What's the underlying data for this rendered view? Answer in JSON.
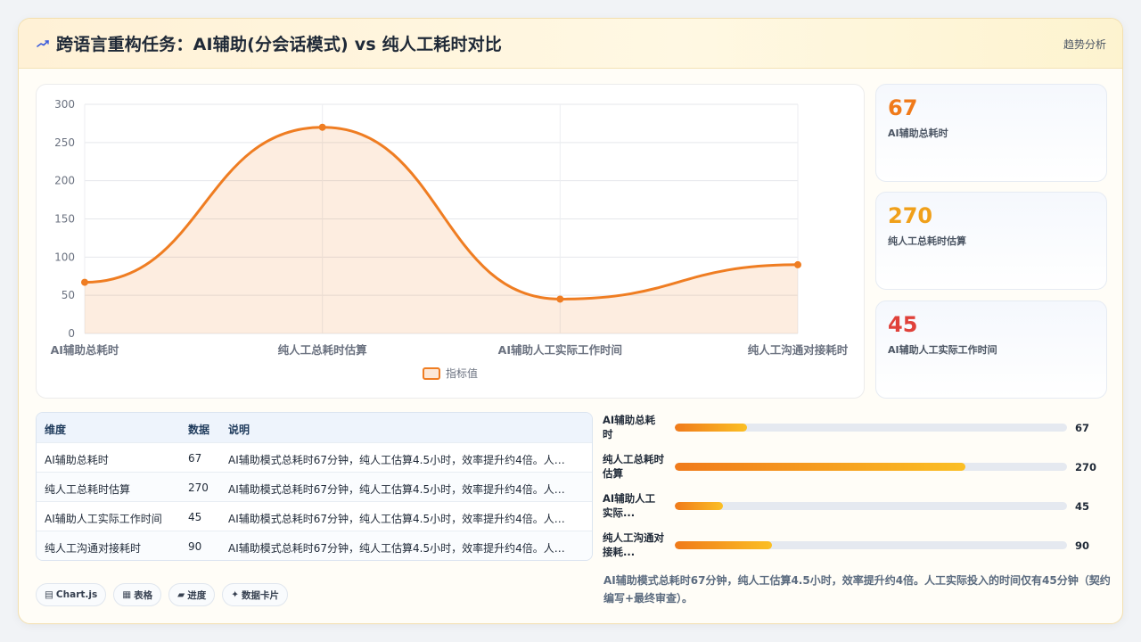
{
  "header": {
    "title": "跨语言重构任务：AI辅助(分会话模式) vs 纯人工耗时对比",
    "trend": "趋势分析",
    "icon": "trend-arrow-icon"
  },
  "chart_data": {
    "type": "line",
    "categories": [
      "AI辅助总耗时",
      "纯人工总耗时估算",
      "AI辅助人工实际工作时间",
      "纯人工沟通对接耗时"
    ],
    "series": [
      {
        "name": "指标值",
        "values": [
          67,
          270,
          45,
          90
        ],
        "color": "#ef7d22"
      }
    ],
    "ylim": [
      0,
      300
    ],
    "yticks": [
      "0",
      "50",
      "100",
      "150",
      "200",
      "250",
      "300"
    ],
    "grid": true,
    "fill": true,
    "legend": "bottom",
    "xlabel": "",
    "ylabel": ""
  },
  "kpis": [
    {
      "value": "67",
      "label": "AI辅助总耗时",
      "color": "#f07a1a"
    },
    {
      "value": "270",
      "label": "纯人工总耗时估算",
      "color": "#f0a01a"
    },
    {
      "value": "45",
      "label": "AI辅助人工实际工作时间",
      "color": "#e0413a"
    }
  ],
  "table": {
    "headers": [
      "维度",
      "数据",
      "说明"
    ],
    "rows": [
      [
        "AI辅助总耗时",
        "67",
        "AI辅助模式总耗时67分钟，纯人工估算4.5小时，效率提升约4倍。人工实际投入的时间仅有45分钟"
      ],
      [
        "纯人工总耗时估算",
        "270",
        "AI辅助模式总耗时67分钟，纯人工估算4.5小时，效率提升约4倍。人工实际投入的时间仅有45分钟"
      ],
      [
        "AI辅助人工实际工作时间",
        "45",
        "AI辅助模式总耗时67分钟，纯人工估算4.5小时，效率提升约4倍。人工实际投入的时间仅有45分钟"
      ],
      [
        "纯人工沟通对接耗时",
        "90",
        "AI辅助模式总耗时67分钟，纯人工估算4.5小时，效率提升约4倍。人工实际投入的时间仅有45分钟"
      ]
    ]
  },
  "progress": {
    "max": 270,
    "items": [
      {
        "label": "AI辅助总耗时",
        "label_display": [
          "AI辅助总耗",
          "时"
        ],
        "value": 67,
        "value_text": "67"
      },
      {
        "label": "纯人工总耗时估算",
        "label_display": [
          "纯人工总耗时",
          "估算"
        ],
        "value": 270,
        "value_text": "270"
      },
      {
        "label": "AI辅助人工实际工作时间",
        "label_display": [
          "AI辅助人工",
          "实际..."
        ],
        "value": 45,
        "value_text": "45"
      },
      {
        "label": "纯人工沟通对接耗时",
        "label_display": [
          "纯人工沟通对",
          "接耗..."
        ],
        "value": 90,
        "value_text": "90"
      }
    ]
  },
  "tags": [
    {
      "icon": "chart-icon",
      "glyph": "▤",
      "label": "Chart.js"
    },
    {
      "icon": "table-icon",
      "glyph": "▦",
      "label": "表格"
    },
    {
      "icon": "progress-icon",
      "glyph": "▰",
      "label": "进度"
    },
    {
      "icon": "card-icon",
      "glyph": "✦",
      "label": "数据卡片"
    }
  ],
  "note": "AI辅助模式总耗时67分钟，纯人工估算4.5小时，效率提升约4倍。人工实际投入的时间仅有45分钟（契约编写+最终审查）。"
}
